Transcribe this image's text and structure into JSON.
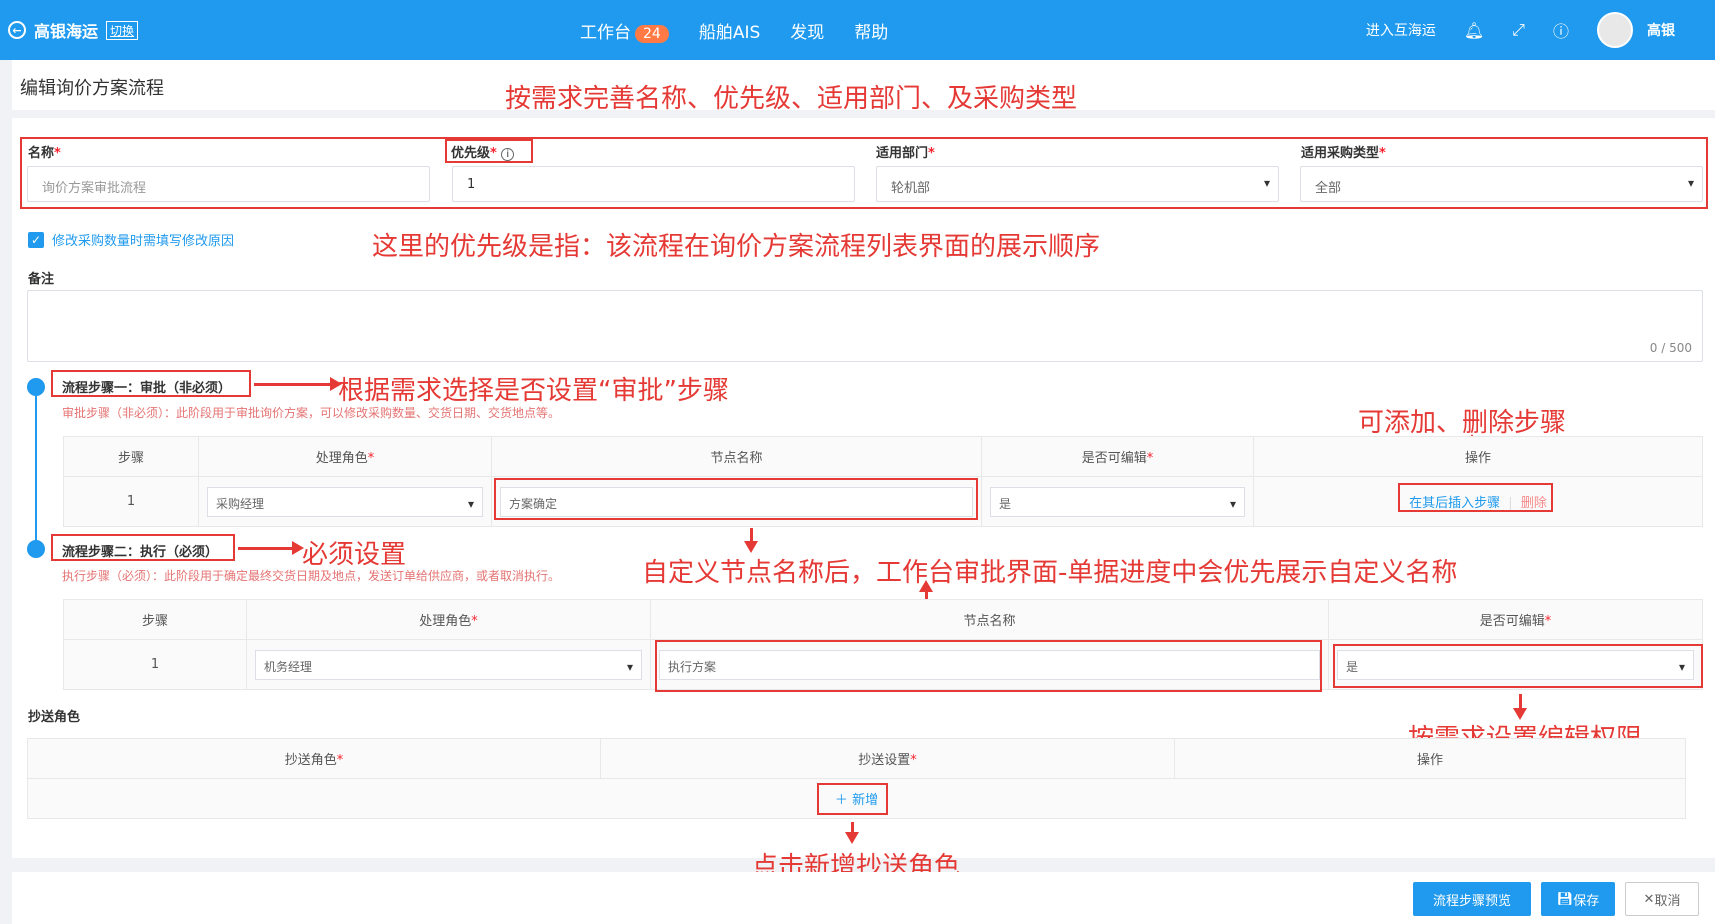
{
  "header": {
    "brand": "高银海运",
    "switch_label": "切换",
    "nav": [
      {
        "label": "工作台",
        "badge": "24"
      },
      {
        "label": "船舶AIS"
      },
      {
        "label": "发现"
      },
      {
        "label": "帮助"
      }
    ],
    "enter_link": "进入互海运",
    "username": "高银"
  },
  "page_title": "编辑询价方案流程",
  "form": {
    "name": {
      "label": "名称",
      "placeholder": "询价方案审批流程"
    },
    "priority": {
      "label": "优先级",
      "value": "1"
    },
    "department": {
      "label": "适用部门",
      "value": "轮机部"
    },
    "purchase_type": {
      "label": "适用采购类型",
      "value": "全部"
    },
    "checkbox_label": "修改采购数量时需填写修改原因",
    "remarks": {
      "label": "备注",
      "counter": "0 / 500"
    }
  },
  "steps": [
    {
      "title": "流程步骤一：审批（非必须）",
      "desc": "审批步骤（非必须）：此阶段用于审批询价方案，可以修改采购数量、交货日期、交货地点等。",
      "columns": [
        "步骤",
        "处理角色",
        "节点名称",
        "是否可编辑",
        "操作"
      ],
      "row": {
        "index": "1",
        "role": "采购经理",
        "node_name": "方案确定",
        "editable": "是",
        "action_insert": "在其后插入步骤",
        "action_delete": "删除"
      }
    },
    {
      "title": "流程步骤二：执行（必须）",
      "desc": "执行步骤（必须）：此阶段用于确定最终交货日期及地点，发送订单给供应商，或者取消执行。",
      "columns": [
        "步骤",
        "处理角色",
        "节点名称",
        "是否可编辑"
      ],
      "row": {
        "index": "1",
        "role": "机务经理",
        "node_name": "执行方案",
        "editable": "是"
      }
    }
  ],
  "cc": {
    "label": "抄送角色",
    "columns": [
      "抄送角色",
      "抄送设置",
      "操作"
    ],
    "add_label": "新增"
  },
  "footer": {
    "preview": "流程步骤预览",
    "save": "保存",
    "cancel": "取消"
  },
  "annotations": {
    "a1": "按需求完善名称、优先级、适用部门、及采购类型",
    "a2": "这里的优先级是指：该流程在询价方案流程列表界面的展示顺序",
    "a3": "根据需求选择是否设置“审批”步骤",
    "a4": "可添加、删除步骤",
    "a5": "必须设置",
    "a6": "自定义节点名称后，工作台审批界面-单据进度中会优先展示自定义名称",
    "a7": "按需求设置编辑权限",
    "a8": "点击新增抄送角色"
  },
  "colors": {
    "primary": "#1f9aee",
    "annotation": "#e53935"
  }
}
